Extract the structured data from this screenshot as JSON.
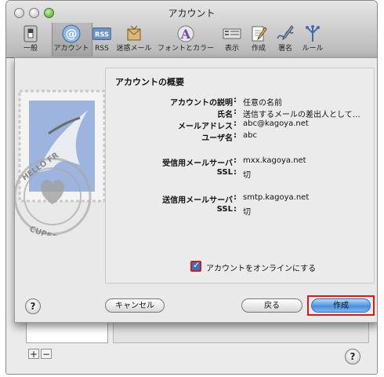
{
  "window": {
    "title": "アカウント"
  },
  "toolbar": {
    "items": [
      {
        "label": "一般",
        "icon": "switch-icon"
      },
      {
        "label": "アカウント",
        "icon": "at-icon"
      },
      {
        "label": "RSS",
        "icon": "rss-icon"
      },
      {
        "label": "迷惑メール",
        "icon": "junk-mail-icon"
      },
      {
        "label": "フォントとカラー",
        "icon": "font-color-icon"
      },
      {
        "label": "表示",
        "icon": "display-icon"
      },
      {
        "label": "作成",
        "icon": "compose-icon"
      },
      {
        "label": "署名",
        "icon": "signature-icon"
      },
      {
        "label": "ルール",
        "icon": "rules-icon"
      }
    ],
    "selected": "アカウント"
  },
  "sheet": {
    "panel_title": "アカウントの概要",
    "fields": [
      {
        "label": "アカウントの説明",
        "value": "任意の名前"
      },
      {
        "label": "氏名",
        "value": "送信するメールの差出人として…"
      },
      {
        "label": "メールアドレス",
        "value": "abc@kagoya.net"
      },
      {
        "label": "ユーザ名",
        "value": "abc"
      },
      {
        "label": "受信用メールサーバ",
        "value": "mxx.kagoya.net"
      },
      {
        "label": "SSL",
        "value": "切"
      },
      {
        "label": "送信用メールサーバ",
        "value": "smtp.kagoya.net"
      },
      {
        "label": "SSL",
        "value": "切"
      }
    ],
    "online_checkbox": {
      "label": "アカウントをオンラインにする",
      "checked": true
    },
    "buttons": {
      "cancel": "キャンセル",
      "back": "戻る",
      "create": "作成"
    },
    "stamp_text": {
      "top": "HELLO FR",
      "bottom": "CUPERTINO"
    }
  },
  "background": {
    "add_label": "+",
    "remove_label": "−"
  },
  "help_label": "?",
  "colors": {
    "highlight_frame": "#d31b1b",
    "primary_button": "#4a8fe0",
    "checkbox": "#3c6fc2"
  }
}
